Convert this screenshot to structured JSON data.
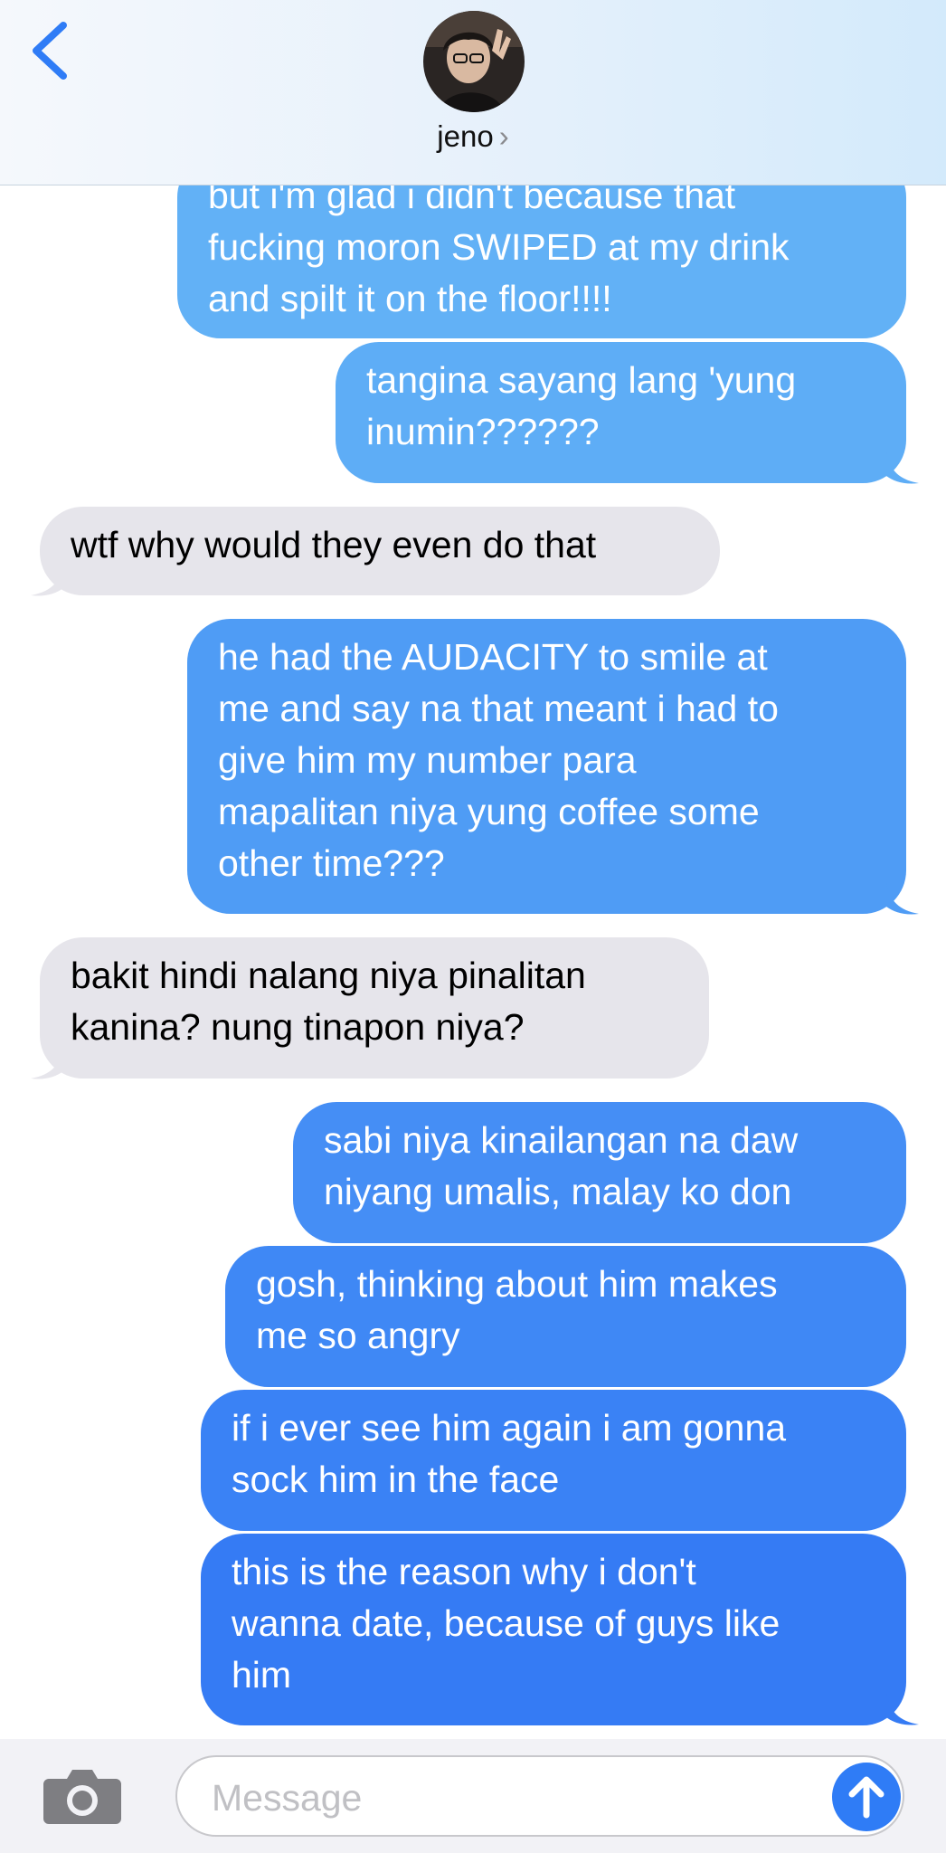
{
  "header": {
    "contact_name": "jeno",
    "chevron": "›"
  },
  "messages": [
    {
      "from": "me",
      "text": "but i'm glad i didn't because that\nfucking moron SWIPED at my drink\nand spilt it on the floor!!!!"
    },
    {
      "from": "me",
      "text": "tangina sayang lang 'yung\ninumin??????"
    },
    {
      "from": "them",
      "text": "wtf why would they even do that"
    },
    {
      "from": "me",
      "text": "he had the AUDACITY to smile at\nme and say na that meant i had to\ngive him my number para\nmapalitan niya yung coffee some\nother time???"
    },
    {
      "from": "them",
      "text": "bakit hindi nalang niya pinalitan\nkanina? nung tinapon niya?"
    },
    {
      "from": "me",
      "text": "sabi niya kinailangan na daw\nniyang umalis, malay ko don"
    },
    {
      "from": "me",
      "text": "gosh, thinking about him makes\nme so angry"
    },
    {
      "from": "me",
      "text": "if i ever see him again i am gonna\nsock him in the face"
    },
    {
      "from": "me",
      "text": "this is the reason why i don't\nwanna date, because of guys like\nhim"
    }
  ],
  "composer": {
    "placeholder": "Message"
  },
  "icons": {
    "back": "chevron-left-icon",
    "camera": "camera-icon",
    "send": "arrow-up-icon"
  },
  "colors": {
    "sent_top": "#6ab9f6",
    "sent_bottom": "#3478f4",
    "received": "#e6e5eb",
    "accent": "#2f7cf6"
  }
}
